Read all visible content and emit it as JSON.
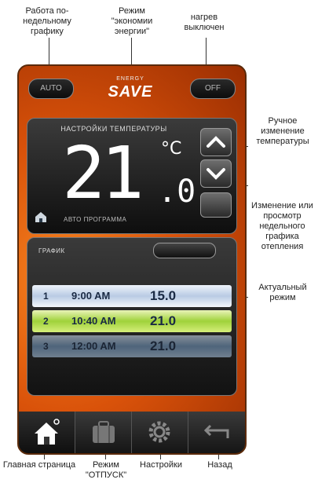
{
  "annotations": {
    "top_left": "Работа по-\nнедельному\nграфику",
    "top_center": "Режим\n\"экономии\nэнергии\"",
    "top_right": "нагрев\nвыключен",
    "right_1": "Ручное\nизменение\nтемпературы",
    "right_2": "Изменение или\nпросмотр\nнедельного\nграфика отепления",
    "right_3": "Актуальный\nрежим",
    "bottom_1": "Главная страница",
    "bottom_2": "Режим\n\"ОТПУСК\"",
    "bottom_3": "Настройки",
    "bottom_4": "Назад"
  },
  "topbar": {
    "auto_label": "AUTO",
    "logo_small": "ENERGY",
    "logo_big": "SAVE",
    "off_label": "OFF"
  },
  "temperature": {
    "title": "НАСТРОЙКИ ТЕМПЕРАТУРЫ",
    "whole": "21",
    "unit": "°C",
    "fraction": ".0",
    "mode_label": "АВТО ПРОГРАММА"
  },
  "schedule": {
    "label": "ГРАФИК",
    "toggle_label": "",
    "rows": [
      {
        "num": "1",
        "time": "9:00 AM",
        "temp": "15.0"
      },
      {
        "num": "2",
        "time": "10:40 AM",
        "temp": "21.0"
      },
      {
        "num": "3",
        "time": "12:00 AM",
        "temp": "21.0"
      }
    ]
  },
  "colors": {
    "background_orange": "#d9520a",
    "active_row": "#9fd23a",
    "inactive_row": "#b9cbe4"
  }
}
